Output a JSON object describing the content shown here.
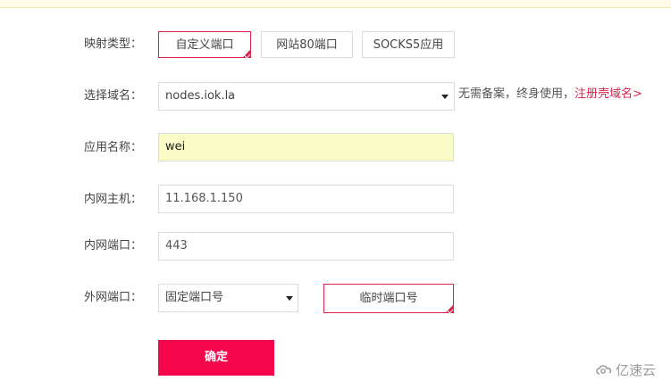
{
  "form": {
    "mapping_type": {
      "label": "映射类型：",
      "options": [
        "自定义端口",
        "网站80端口",
        "SOCKS5应用"
      ],
      "selected": "自定义端口"
    },
    "domain": {
      "label": "选择域名：",
      "value": "nodes.iok.la",
      "hint": "无需备案，终身使用，",
      "hint_link": "注册壳域名>"
    },
    "app_name": {
      "label": "应用名称：",
      "value": "wei"
    },
    "intranet_host": {
      "label": "内网主机：",
      "value": "11.168.1.150"
    },
    "intranet_port": {
      "label": "内网端口：",
      "value": "443"
    },
    "external_port": {
      "label": "外网端口：",
      "select_value": "固定端口号",
      "temp_button": "临时端口号"
    },
    "submit_label": "确定"
  },
  "watermark": {
    "text": "亿速云"
  },
  "colors": {
    "accent": "#d9234b",
    "submit_bg": "#f5064a",
    "highlight_bg": "#fafcc8",
    "top_strip": "#fffbe6"
  }
}
